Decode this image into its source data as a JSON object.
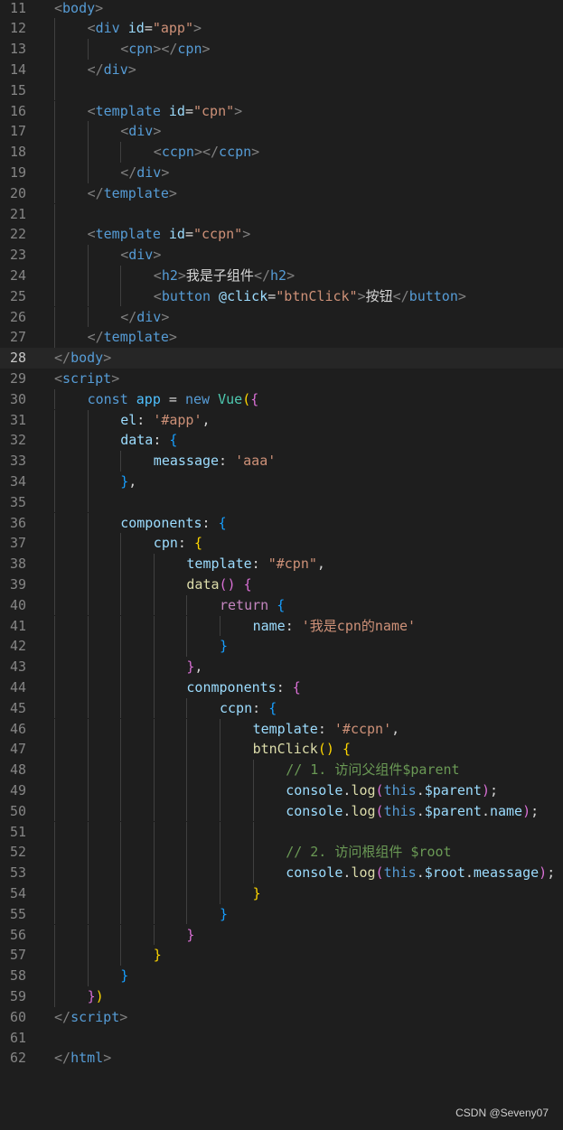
{
  "editor": {
    "active_line": 28,
    "lines": [
      {
        "n": "11",
        "indent": 0,
        "tokens": [
          [
            "<",
            "tag"
          ],
          [
            "body",
            "name"
          ],
          [
            ">",
            "tag"
          ]
        ]
      },
      {
        "n": "12",
        "indent": 1,
        "tokens": [
          [
            "<",
            "tag"
          ],
          [
            "div",
            "name"
          ],
          [
            " ",
            "plain"
          ],
          [
            "id",
            "attr"
          ],
          [
            "=",
            "plain"
          ],
          [
            "\"app\"",
            "str"
          ],
          [
            ">",
            "tag"
          ]
        ]
      },
      {
        "n": "13",
        "indent": 2,
        "tokens": [
          [
            "<",
            "tag"
          ],
          [
            "cpn",
            "name"
          ],
          [
            "></",
            "tag"
          ],
          [
            "cpn",
            "name"
          ],
          [
            ">",
            "tag"
          ]
        ]
      },
      {
        "n": "14",
        "indent": 1,
        "tokens": [
          [
            "</",
            "tag"
          ],
          [
            "div",
            "name"
          ],
          [
            ">",
            "tag"
          ]
        ]
      },
      {
        "n": "15",
        "indent": 1,
        "tokens": []
      },
      {
        "n": "16",
        "indent": 1,
        "tokens": [
          [
            "<",
            "tag"
          ],
          [
            "template",
            "name"
          ],
          [
            " ",
            "plain"
          ],
          [
            "id",
            "attr"
          ],
          [
            "=",
            "plain"
          ],
          [
            "\"cpn\"",
            "str"
          ],
          [
            ">",
            "tag"
          ]
        ]
      },
      {
        "n": "17",
        "indent": 2,
        "tokens": [
          [
            "<",
            "tag"
          ],
          [
            "div",
            "name"
          ],
          [
            ">",
            "tag"
          ]
        ]
      },
      {
        "n": "18",
        "indent": 3,
        "tokens": [
          [
            "<",
            "tag"
          ],
          [
            "ccpn",
            "name"
          ],
          [
            "></",
            "tag"
          ],
          [
            "ccpn",
            "name"
          ],
          [
            ">",
            "tag"
          ]
        ]
      },
      {
        "n": "19",
        "indent": 2,
        "tokens": [
          [
            "</",
            "tag"
          ],
          [
            "div",
            "name"
          ],
          [
            ">",
            "tag"
          ]
        ]
      },
      {
        "n": "20",
        "indent": 1,
        "tokens": [
          [
            "</",
            "tag"
          ],
          [
            "template",
            "name"
          ],
          [
            ">",
            "tag"
          ]
        ]
      },
      {
        "n": "21",
        "indent": 1,
        "tokens": []
      },
      {
        "n": "22",
        "indent": 1,
        "tokens": [
          [
            "<",
            "tag"
          ],
          [
            "template",
            "name"
          ],
          [
            " ",
            "plain"
          ],
          [
            "id",
            "attr"
          ],
          [
            "=",
            "plain"
          ],
          [
            "\"ccpn\"",
            "str"
          ],
          [
            ">",
            "tag"
          ]
        ]
      },
      {
        "n": "23",
        "indent": 2,
        "tokens": [
          [
            "<",
            "tag"
          ],
          [
            "div",
            "name"
          ],
          [
            ">",
            "tag"
          ]
        ]
      },
      {
        "n": "24",
        "indent": 3,
        "tokens": [
          [
            "<",
            "tag"
          ],
          [
            "h2",
            "name"
          ],
          [
            ">",
            "tag"
          ],
          [
            "我是子组件",
            "plain"
          ],
          [
            "</",
            "tag"
          ],
          [
            "h2",
            "name"
          ],
          [
            ">",
            "tag"
          ]
        ]
      },
      {
        "n": "25",
        "indent": 3,
        "tokens": [
          [
            "<",
            "tag"
          ],
          [
            "button",
            "name"
          ],
          [
            " ",
            "plain"
          ],
          [
            "@click",
            "attr"
          ],
          [
            "=",
            "plain"
          ],
          [
            "\"btnClick\"",
            "str"
          ],
          [
            ">",
            "tag"
          ],
          [
            "按钮",
            "plain"
          ],
          [
            "</",
            "tag"
          ],
          [
            "button",
            "name"
          ],
          [
            ">",
            "tag"
          ]
        ]
      },
      {
        "n": "26",
        "indent": 2,
        "tokens": [
          [
            "</",
            "tag"
          ],
          [
            "div",
            "name"
          ],
          [
            ">",
            "tag"
          ]
        ]
      },
      {
        "n": "27",
        "indent": 1,
        "tokens": [
          [
            "</",
            "tag"
          ],
          [
            "template",
            "name"
          ],
          [
            ">",
            "tag"
          ]
        ]
      },
      {
        "n": "28",
        "indent": 0,
        "tokens": [
          [
            "</",
            "tag"
          ],
          [
            "body",
            "name"
          ],
          [
            ">",
            "tag"
          ]
        ]
      },
      {
        "n": "29",
        "indent": 0,
        "tokens": [
          [
            "<",
            "tag"
          ],
          [
            "script",
            "name"
          ],
          [
            ">",
            "tag"
          ]
        ]
      },
      {
        "n": "30",
        "indent": 1,
        "tokens": [
          [
            "const",
            "kw"
          ],
          [
            " ",
            "plain"
          ],
          [
            "app",
            "const"
          ],
          [
            " = ",
            "plain"
          ],
          [
            "new",
            "kw"
          ],
          [
            " ",
            "plain"
          ],
          [
            "Vue",
            "cls"
          ],
          [
            "(",
            "b1"
          ],
          [
            "{",
            "b2"
          ]
        ]
      },
      {
        "n": "31",
        "indent": 2,
        "tokens": [
          [
            "el",
            "prop"
          ],
          [
            ": ",
            "plain"
          ],
          [
            "'#app'",
            "str"
          ],
          [
            ",",
            "plain"
          ]
        ]
      },
      {
        "n": "32",
        "indent": 2,
        "tokens": [
          [
            "data",
            "prop"
          ],
          [
            ": ",
            "plain"
          ],
          [
            "{",
            "b3"
          ]
        ]
      },
      {
        "n": "33",
        "indent": 3,
        "tokens": [
          [
            "meassage",
            "prop"
          ],
          [
            ": ",
            "plain"
          ],
          [
            "'aaa'",
            "str"
          ]
        ]
      },
      {
        "n": "34",
        "indent": 2,
        "tokens": [
          [
            "}",
            "b3"
          ],
          [
            ",",
            "plain"
          ]
        ]
      },
      {
        "n": "35",
        "indent": 2,
        "tokens": []
      },
      {
        "n": "36",
        "indent": 2,
        "tokens": [
          [
            "components",
            "prop"
          ],
          [
            ": ",
            "plain"
          ],
          [
            "{",
            "b3"
          ]
        ]
      },
      {
        "n": "37",
        "indent": 3,
        "tokens": [
          [
            "cpn",
            "prop"
          ],
          [
            ": ",
            "plain"
          ],
          [
            "{",
            "b1"
          ]
        ]
      },
      {
        "n": "38",
        "indent": 4,
        "tokens": [
          [
            "template",
            "prop"
          ],
          [
            ": ",
            "plain"
          ],
          [
            "\"#cpn\"",
            "str"
          ],
          [
            ",",
            "plain"
          ]
        ]
      },
      {
        "n": "39",
        "indent": 4,
        "tokens": [
          [
            "data",
            "fn"
          ],
          [
            "()",
            "b2"
          ],
          [
            " ",
            "plain"
          ],
          [
            "{",
            "b2"
          ]
        ]
      },
      {
        "n": "40",
        "indent": 5,
        "tokens": [
          [
            "return",
            "ctrl"
          ],
          [
            " ",
            "plain"
          ],
          [
            "{",
            "b3"
          ]
        ]
      },
      {
        "n": "41",
        "indent": 6,
        "tokens": [
          [
            "name",
            "prop"
          ],
          [
            ": ",
            "plain"
          ],
          [
            "'我是cpn的name'",
            "str"
          ]
        ]
      },
      {
        "n": "42",
        "indent": 5,
        "tokens": [
          [
            "}",
            "b3"
          ]
        ]
      },
      {
        "n": "43",
        "indent": 4,
        "tokens": [
          [
            "}",
            "b2"
          ],
          [
            ",",
            "plain"
          ]
        ]
      },
      {
        "n": "44",
        "indent": 4,
        "tokens": [
          [
            "conmponents",
            "prop"
          ],
          [
            ": ",
            "plain"
          ],
          [
            "{",
            "b2"
          ]
        ]
      },
      {
        "n": "45",
        "indent": 5,
        "tokens": [
          [
            "ccpn",
            "prop"
          ],
          [
            ": ",
            "plain"
          ],
          [
            "{",
            "b3"
          ]
        ]
      },
      {
        "n": "46",
        "indent": 6,
        "tokens": [
          [
            "template",
            "prop"
          ],
          [
            ": ",
            "plain"
          ],
          [
            "'#ccpn'",
            "str"
          ],
          [
            ",",
            "plain"
          ]
        ]
      },
      {
        "n": "47",
        "indent": 6,
        "tokens": [
          [
            "btnClick",
            "fn"
          ],
          [
            "()",
            "b1"
          ],
          [
            " ",
            "plain"
          ],
          [
            "{",
            "b1"
          ]
        ]
      },
      {
        "n": "48",
        "indent": 7,
        "tokens": [
          [
            "// 1. 访问父组件$parent",
            "com"
          ]
        ]
      },
      {
        "n": "49",
        "indent": 7,
        "tokens": [
          [
            "console",
            "var"
          ],
          [
            ".",
            "plain"
          ],
          [
            "log",
            "fn"
          ],
          [
            "(",
            "b2"
          ],
          [
            "this",
            "kw"
          ],
          [
            ".",
            "plain"
          ],
          [
            "$parent",
            "var"
          ],
          [
            ")",
            "b2"
          ],
          [
            ";",
            "plain"
          ]
        ]
      },
      {
        "n": "50",
        "indent": 7,
        "tokens": [
          [
            "console",
            "var"
          ],
          [
            ".",
            "plain"
          ],
          [
            "log",
            "fn"
          ],
          [
            "(",
            "b2"
          ],
          [
            "this",
            "kw"
          ],
          [
            ".",
            "plain"
          ],
          [
            "$parent",
            "var"
          ],
          [
            ".",
            "plain"
          ],
          [
            "name",
            "var"
          ],
          [
            ")",
            "b2"
          ],
          [
            ";",
            "plain"
          ]
        ]
      },
      {
        "n": "51",
        "indent": 7,
        "tokens": []
      },
      {
        "n": "52",
        "indent": 7,
        "tokens": [
          [
            "// 2. 访问根组件 $root",
            "com"
          ]
        ]
      },
      {
        "n": "53",
        "indent": 7,
        "tokens": [
          [
            "console",
            "var"
          ],
          [
            ".",
            "plain"
          ],
          [
            "log",
            "fn"
          ],
          [
            "(",
            "b2"
          ],
          [
            "this",
            "kw"
          ],
          [
            ".",
            "plain"
          ],
          [
            "$root",
            "var"
          ],
          [
            ".",
            "plain"
          ],
          [
            "meassage",
            "var"
          ],
          [
            ")",
            "b2"
          ],
          [
            ";",
            "plain"
          ]
        ]
      },
      {
        "n": "54",
        "indent": 6,
        "tokens": [
          [
            "}",
            "b1"
          ]
        ]
      },
      {
        "n": "55",
        "indent": 5,
        "tokens": [
          [
            "}",
            "b3"
          ]
        ]
      },
      {
        "n": "56",
        "indent": 4,
        "tokens": [
          [
            "}",
            "b2"
          ]
        ]
      },
      {
        "n": "57",
        "indent": 3,
        "tokens": [
          [
            "}",
            "b1"
          ]
        ]
      },
      {
        "n": "58",
        "indent": 2,
        "tokens": [
          [
            "}",
            "b3"
          ]
        ]
      },
      {
        "n": "59",
        "indent": 1,
        "tokens": [
          [
            "}",
            "b2"
          ],
          [
            ")",
            "b1"
          ]
        ]
      },
      {
        "n": "60",
        "indent": 0,
        "tokens": [
          [
            "</",
            "tag"
          ],
          [
            "script",
            "name"
          ],
          [
            ">",
            "tag"
          ]
        ]
      },
      {
        "n": "61",
        "indent": 0,
        "tokens": []
      },
      {
        "n": "62",
        "indent": 0,
        "tokens": [
          [
            "</",
            "tag"
          ],
          [
            "html",
            "name"
          ],
          [
            ">",
            "tag"
          ]
        ]
      }
    ]
  },
  "watermark": "CSDN @Seveny07"
}
